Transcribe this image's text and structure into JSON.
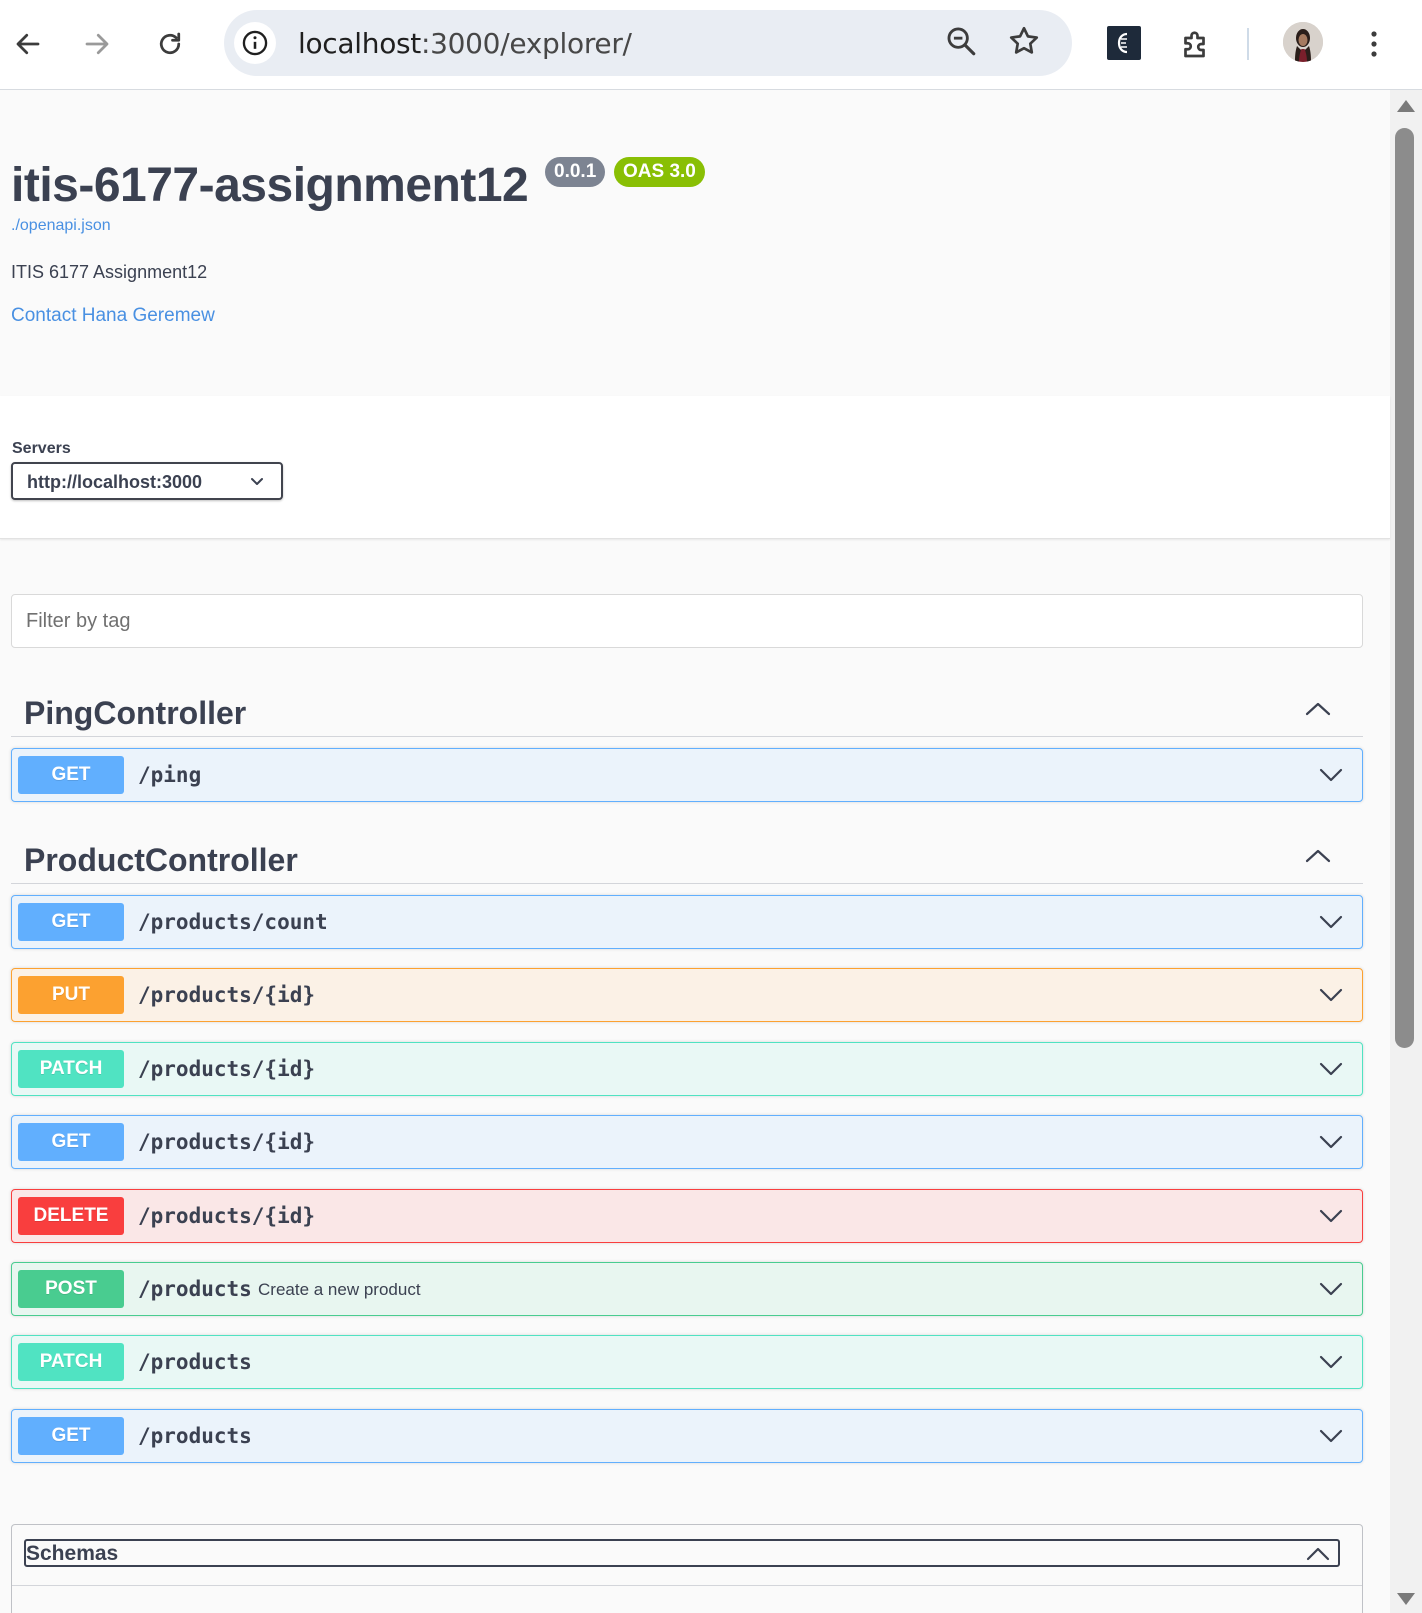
{
  "browser": {
    "url_host": "localhost",
    "url_rest": ":3000/explorer/"
  },
  "info": {
    "title": "itis-6177-assignment12",
    "version_badge": "0.0.1",
    "oas_badge": "OAS 3.0",
    "spec_link": "./openapi.json",
    "description": "ITIS 6177 Assignment12",
    "contact": "Contact Hana Geremew"
  },
  "servers": {
    "label": "Servers",
    "selected": "http://localhost:3000"
  },
  "filter": {
    "placeholder": "Filter by tag"
  },
  "tags": [
    {
      "name": "PingController",
      "operations": [
        {
          "method": "GET",
          "path": "/ping",
          "summary": ""
        }
      ]
    },
    {
      "name": "ProductController",
      "operations": [
        {
          "method": "GET",
          "path": "/products/count",
          "summary": ""
        },
        {
          "method": "PUT",
          "path": "/products/{id}",
          "summary": ""
        },
        {
          "method": "PATCH",
          "path": "/products/{id}",
          "summary": ""
        },
        {
          "method": "GET",
          "path": "/products/{id}",
          "summary": ""
        },
        {
          "method": "DELETE",
          "path": "/products/{id}",
          "summary": ""
        },
        {
          "method": "POST",
          "path": "/products",
          "summary": "Create a new product"
        },
        {
          "method": "PATCH",
          "path": "/products",
          "summary": ""
        },
        {
          "method": "GET",
          "path": "/products",
          "summary": ""
        }
      ]
    }
  ],
  "schemas": {
    "label": "Schemas"
  },
  "colors": {
    "get": "#61affe",
    "put": "#fca130",
    "patch": "#50e3c2",
    "delete": "#f93e3e",
    "post": "#49cc90",
    "link": "#4990e2",
    "text": "#3b4151"
  },
  "icons": {
    "back": "arrow-left-icon",
    "forward": "arrow-right-icon",
    "reload": "reload-icon",
    "site_info": "info-icon",
    "zoom": "zoom-out-icon",
    "bookmark": "star-icon",
    "extension": "extension-icon",
    "extensions_menu": "puzzle-icon",
    "profile": "avatar",
    "menu": "kebab-menu-icon"
  }
}
